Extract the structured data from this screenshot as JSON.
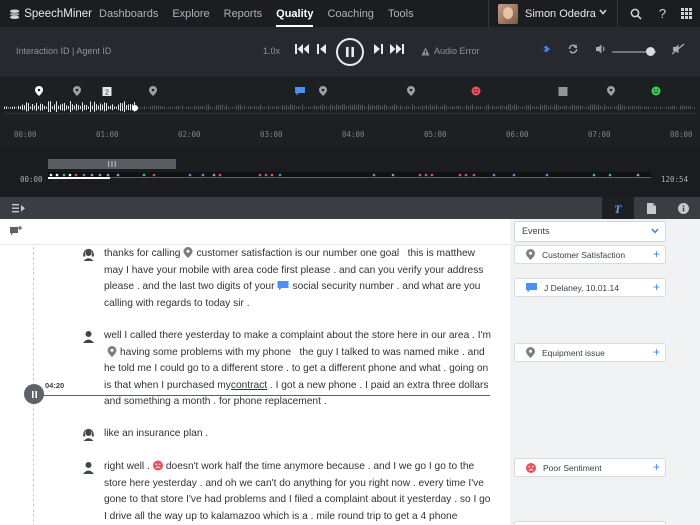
{
  "app": {
    "brand": "SpeechMiner"
  },
  "nav": {
    "links": [
      "Dashboards",
      "Explore",
      "Reports",
      "Quality",
      "Coaching",
      "Tools"
    ],
    "active": "Quality"
  },
  "user": {
    "name": "Simon Odedra"
  },
  "player": {
    "ids_label": "Interaction ID | Agent ID",
    "speed": "1.0x",
    "audio_status": "Audio Error",
    "volume_level": 0.8
  },
  "timeline": {
    "ticks": [
      "00:00",
      "01:00",
      "02:00",
      "03:00",
      "04:00",
      "05:00",
      "06:00",
      "07:00",
      "08:00"
    ],
    "markers": [
      {
        "icon": "pin-icon",
        "label": ""
      },
      {
        "icon": "pin-icon",
        "label": ""
      },
      {
        "icon": "doc-icon",
        "label": "2"
      },
      {
        "icon": "pin-icon",
        "label": ""
      },
      {
        "icon": "comment-icon",
        "label": ""
      },
      {
        "icon": "pin-icon",
        "label": ""
      },
      {
        "icon": "pin-icon",
        "label": ""
      },
      {
        "icon": "sad-face-icon",
        "label": ""
      },
      {
        "icon": "doc-icon",
        "label": ""
      },
      {
        "icon": "pin-icon",
        "label": ""
      },
      {
        "icon": "happy-face-icon",
        "label": ""
      }
    ]
  },
  "overview": {
    "start": "00:00",
    "end": "120:54"
  },
  "transcript": {
    "playhead_time": "04:20",
    "paragraphs": [
      {
        "speaker": "agent",
        "lines": [
          [
            "thanks for calling",
            "pin",
            "customer satisfaction is our number one goal   this is matthew"
          ],
          [
            "may I have your mobile with area code first please . and can you verify your address"
          ],
          [
            "please . and the last two digits of your",
            "comment",
            "social security number . and what are you"
          ],
          [
            "calling with regards to today sir ."
          ]
        ]
      },
      {
        "speaker": "customer",
        "lines": [
          [
            "well I called there yesterday to make a complaint about the store here in our area . I'm"
          ],
          [
            "pin",
            "having some problems with my phone   the guy I talked to was named mike . and"
          ],
          [
            "he told me I could go to a different store . to get a different phone and what . going on"
          ],
          [
            "is that when I purchased my",
            "u:contract",
            " . I got a new phone . I paid an extra three dollars"
          ],
          [
            "and something a month . for phone replacement ."
          ]
        ]
      },
      {
        "speaker": "agent",
        "lines": [
          [
            "like an insurance plan ."
          ]
        ]
      },
      {
        "speaker": "customer",
        "lines": [
          [
            "right well .",
            "sad",
            "doesn't work half the time anymore because . and I we go I go to the"
          ],
          [
            "store here yesterday . and oh we can't do anything for you right now . every time I've"
          ],
          [
            "gone to that store I've had problems and I filed a complaint about it yesterday . so I go"
          ],
          [
            "I drive all the way up to kalamazoo which is a . mile round trip to get a 4 phone"
          ]
        ]
      }
    ]
  },
  "events": {
    "filter_label": "Events",
    "items": [
      {
        "icon": "pin-icon",
        "label": "Customer Satisfaction"
      },
      {
        "icon": "comment-icon",
        "label": "J Delaney, 10.01.14"
      },
      {
        "icon": "pin-icon",
        "label": "Equipment issue"
      },
      {
        "icon": "sad-face-icon",
        "label": "Poor Sentiment"
      }
    ]
  },
  "colors": {
    "accent": "#3e82f7",
    "negative": "#e8505b",
    "positive": "#3ccf4e",
    "topbar": "#1b1d20"
  }
}
